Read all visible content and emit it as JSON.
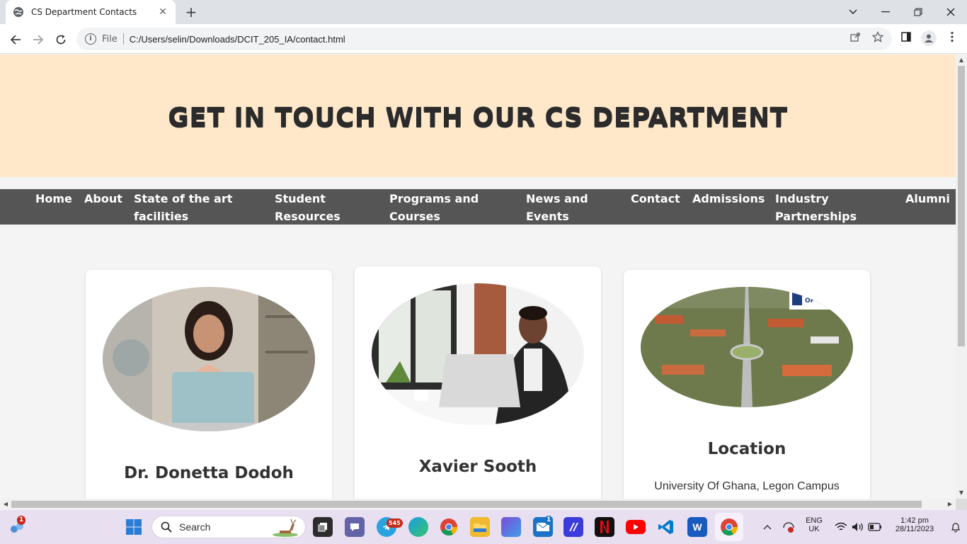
{
  "browser": {
    "tab_title": "CS Department Contacts",
    "tab_close": "✕",
    "new_tab": "+",
    "file_label": "File",
    "url": "C:/Users/selin/Downloads/DCIT_205_IA/contact.html"
  },
  "page": {
    "hero_title": "GET IN TOUCH WITH OUR CS DEPARTMENT",
    "nav": [
      "Home",
      "About",
      "State of the art\nfacilities",
      "Student\nResources",
      "Programs and\nCourses",
      "News and\nEvents",
      "Contact",
      "Admissions",
      "Industry\nPartnerships",
      "Alumni"
    ],
    "cards": [
      {
        "name": "Dr. Donetta Dodoh"
      },
      {
        "name": "Xavier Sooth"
      },
      {
        "name": "Location",
        "detail": "University Of Ghana, Legon Campus"
      }
    ]
  },
  "taskbar": {
    "search_placeholder": "Search",
    "telegram_badge": "545",
    "mail_badge": "1",
    "widgets_badge": "1",
    "lang_top": "ENG",
    "lang_bottom": "UK",
    "time": "1:42 pm",
    "date": "28/11/2023"
  }
}
